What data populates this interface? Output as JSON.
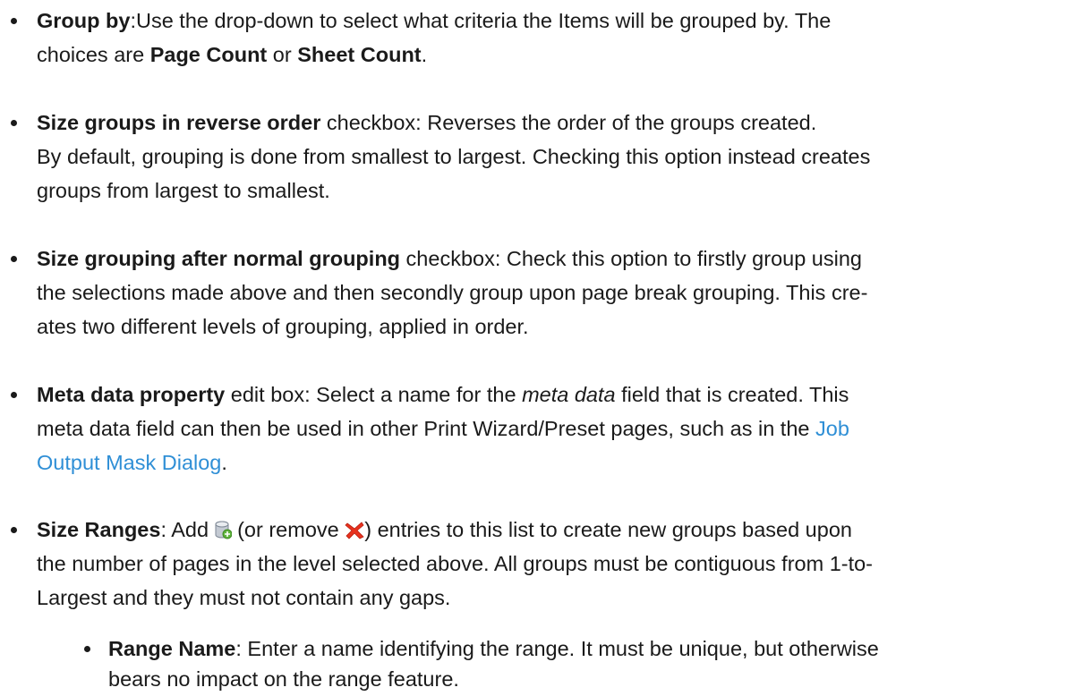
{
  "items": [
    {
      "title": "Group by",
      "lines": [
        ":Use the drop-down to select what criteria the Items will be grouped by. The",
        "choices are "
      ],
      "opt1": "Page Count",
      "or": " or ",
      "opt2": "Sheet Count",
      "end": "."
    },
    {
      "title": "Size groups in reverse order",
      "lines": [
        " checkbox: Reverses the order of the groups created.",
        "By default, grouping is done from smallest to largest. Checking this option instead creates",
        "groups from largest to smallest."
      ]
    },
    {
      "title": "Size grouping after normal grouping",
      "lines": [
        " checkbox: Check this option to firstly group using",
        "the selections made above and then secondly group upon page break grouping. This cre-",
        "ates two different levels of grouping, applied in order."
      ]
    },
    {
      "title": "Meta data property",
      "lines": [
        " edit box: Select a name for the ",
        " field that is created. This",
        "meta data field can then be used in other Print Wizard/Preset pages, such as in the ",
        "."
      ],
      "emph": "meta data",
      "link1": "Job",
      "link2": "Output Mask Dialog"
    },
    {
      "title": "Size Ranges",
      "lines": [
        ": Add ",
        " (or remove ",
        ") entries to this list to create new groups based upon",
        "the number of pages in the level selected above. All groups must be contiguous from 1-to-",
        "Largest and they must not contain any gaps."
      ],
      "icons": {
        "add": "add-database-icon",
        "remove": "remove-x-icon"
      },
      "colors": {
        "remove": "#e8321e",
        "add": "#5fb43c"
      }
    },
    {
      "title": "Range Name",
      "lines": [
        ": Enter a name identifying the range. It must be unique, but otherwise",
        "bears no impact on the range feature."
      ]
    }
  ]
}
